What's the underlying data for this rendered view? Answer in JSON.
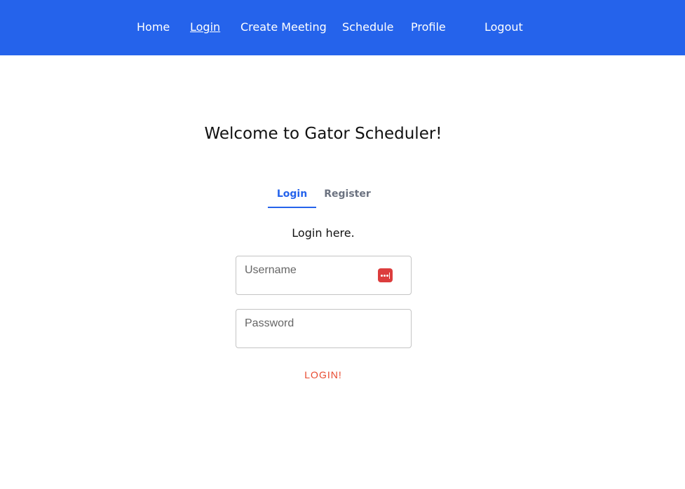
{
  "nav": {
    "home": "Home",
    "login": "Login",
    "create_meeting": "Create Meeting",
    "schedule": "Schedule",
    "profile": "Profile",
    "logout": "Logout"
  },
  "main": {
    "welcome": "Welcome to Gator Scheduler!",
    "tabs": {
      "login": "Login",
      "register": "Register"
    },
    "subtitle": "Login here.",
    "username": {
      "placeholder": "Username",
      "value": ""
    },
    "password": {
      "placeholder": "Password",
      "value": ""
    },
    "login_button": "LOGIN!"
  },
  "colors": {
    "navbar": "#2563eb",
    "tab_active": "#2563eb",
    "button_text": "#e8472c",
    "password_manager_icon": "#dc3d3d"
  },
  "icons": {
    "username_field": "password-manager-icon"
  }
}
